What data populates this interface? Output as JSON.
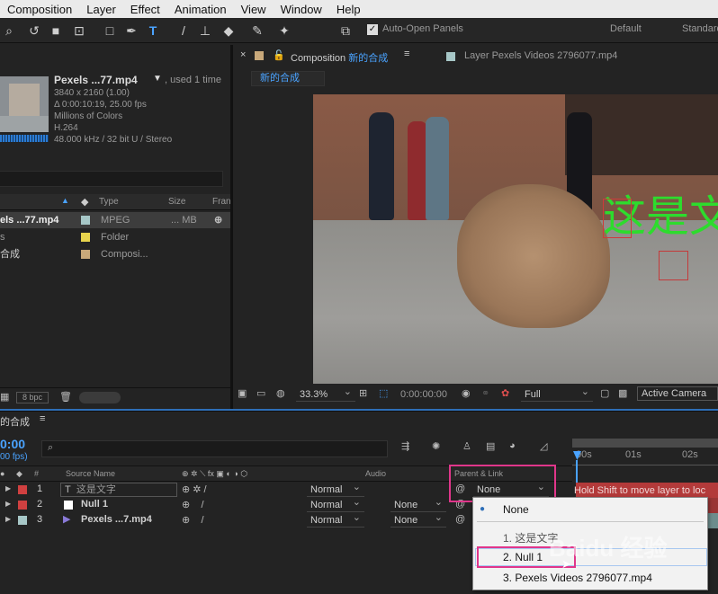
{
  "menu": [
    "Composition",
    "Layer",
    "Effect",
    "Animation",
    "View",
    "Window",
    "Help"
  ],
  "toolbar": {
    "auto_open_label": "Auto-Open Panels",
    "workspace_default": "Default",
    "workspace_standard": "Standard"
  },
  "project": {
    "item_name": "Pexels ...77.mp4",
    "used": ", used 1 time",
    "info": [
      "3840 x 2160 (1.00)",
      "Δ 0:00:10:19, 25.00 fps",
      "Millions of Colors",
      "H.264",
      "48.000 kHz / 32 bit U / Stereo"
    ],
    "col_type": "Type",
    "col_size": "Size",
    "col_fra": "Fran",
    "items": [
      {
        "name": "els ...77.mp4",
        "type": "MPEG",
        "size": "... MB",
        "color": "#a7c7c7"
      },
      {
        "name": "s",
        "type": "Folder",
        "size": "",
        "color": "#e8d44d"
      },
      {
        "name": "合成",
        "type": "Composi...",
        "size": "",
        "color": "#c8a87a"
      }
    ],
    "bpc": "8 bpc"
  },
  "comp_tabs": {
    "comp_prefix": "Composition",
    "comp_name": "新的合成",
    "layer_tab": "Layer  Pexels Videos 2796077.mp4",
    "breadcrumb": "新的合成"
  },
  "viewer": {
    "overlay_text": "这是文",
    "zoom": "33.3%",
    "timecode": "0:00:00:00",
    "resolution": "Full",
    "camera": "Active Camera"
  },
  "timeline": {
    "tab_label": "的合成",
    "time": "0:00",
    "fps": "00 fps)",
    "col_num": "#",
    "col_source": "Source Name",
    "col_audio": "Audio",
    "col_parent": "Parent & Link",
    "ruler": [
      "00s",
      "01s",
      "02s"
    ],
    "tooltip": "Hold Shift to move layer to loc",
    "layers": [
      {
        "num": "1",
        "name": "这是文字",
        "mode": "Normal",
        "parent": "None",
        "color": "#d04040"
      },
      {
        "num": "2",
        "name": "Null 1",
        "mode": "Normal",
        "trkmat": "None",
        "parent": "None",
        "color": "#d04040"
      },
      {
        "num": "3",
        "name": "Pexels ...7.mp4",
        "mode": "Normal",
        "trkmat": "None",
        "parent": "None",
        "color": "#a7c7c7"
      }
    ]
  },
  "parent_menu": {
    "items": [
      "None",
      "1. 这是文字",
      "2. Null 1",
      "3. Pexels Videos 2796077.mp4"
    ]
  },
  "watermark": "Baidu 经验"
}
